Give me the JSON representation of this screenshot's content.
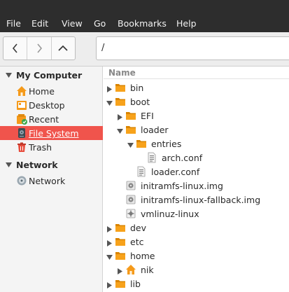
{
  "menubar": {
    "items": [
      "File",
      "Edit",
      "View",
      "Go",
      "Bookmarks",
      "Help"
    ]
  },
  "toolbar": {
    "path": "/"
  },
  "sidebar": {
    "sections": [
      {
        "title": "My Computer",
        "items": [
          {
            "label": "Home",
            "icon": "home-icon"
          },
          {
            "label": "Desktop",
            "icon": "desktop-icon"
          },
          {
            "label": "Recent",
            "icon": "recent-icon"
          },
          {
            "label": "File System",
            "icon": "drive-icon",
            "selected": true
          },
          {
            "label": "Trash",
            "icon": "trash-icon"
          }
        ]
      },
      {
        "title": "Network",
        "items": [
          {
            "label": "Network",
            "icon": "network-icon"
          }
        ]
      }
    ]
  },
  "main": {
    "column_header": "Name",
    "rows": [
      {
        "name": "bin",
        "type": "folder",
        "expander": "collapsed"
      },
      {
        "name": "boot",
        "type": "folder",
        "expander": "expanded"
      },
      {
        "name": "EFI",
        "type": "folder",
        "expander": "collapsed"
      },
      {
        "name": "loader",
        "type": "folder",
        "expander": "expanded"
      },
      {
        "name": "entries",
        "type": "folder",
        "expander": "expanded"
      },
      {
        "name": "arch.conf",
        "type": "text"
      },
      {
        "name": "loader.conf",
        "type": "text"
      },
      {
        "name": "initramfs-linux.img",
        "type": "disk-image"
      },
      {
        "name": "initramfs-linux-fallback.img",
        "type": "disk-image"
      },
      {
        "name": "vmlinuz-linux",
        "type": "binary"
      },
      {
        "name": "dev",
        "type": "folder",
        "expander": "collapsed"
      },
      {
        "name": "etc",
        "type": "folder",
        "expander": "collapsed"
      },
      {
        "name": "home",
        "type": "folder",
        "expander": "expanded"
      },
      {
        "name": "nik",
        "type": "home-folder",
        "expander": "collapsed"
      },
      {
        "name": "lib",
        "type": "folder",
        "expander": "collapsed"
      }
    ]
  },
  "colors": {
    "accent": "#f0544c",
    "folder": "#f7a21b",
    "menubar": "#2d2d2d"
  }
}
